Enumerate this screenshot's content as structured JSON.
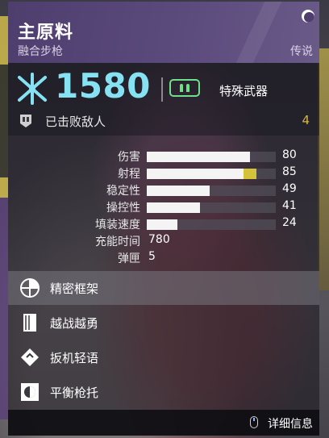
{
  "weapon": {
    "name": "主原料",
    "type": "融合步枪",
    "rarity": "传说",
    "power": "1580",
    "ammo_type": "特殊武器",
    "kills_label": "已击败敌人",
    "kills_value": "4"
  },
  "stats": [
    {
      "label": "伤害",
      "value": "80",
      "fill": 0.8,
      "mod": 0
    },
    {
      "label": "射程",
      "value": "85",
      "fill": 0.75,
      "mod": 0.1
    },
    {
      "label": "稳定性",
      "value": "49",
      "fill": 0.49,
      "mod": 0
    },
    {
      "label": "操控性",
      "value": "41",
      "fill": 0.41,
      "mod": 0
    },
    {
      "label": "填装速度",
      "value": "24",
      "fill": 0.24,
      "mod": 0
    },
    {
      "label": "充能时间",
      "value": "780"
    },
    {
      "label": "弹匣",
      "value": "5"
    }
  ],
  "perks": [
    {
      "label": "精密框架",
      "icon": "precision-frame-icon",
      "selected": true
    },
    {
      "label": "越战越勇",
      "icon": "rampage-icon",
      "selected": false
    },
    {
      "label": "扳机轻语",
      "icon": "triggered-whisper-icon",
      "selected": false
    },
    {
      "label": "平衡枪托",
      "icon": "balanced-stock-icon",
      "selected": false
    }
  ],
  "footer": {
    "details_label": "详细信息"
  },
  "colors": {
    "header": "#4e3e6e",
    "power": "#86e2f2",
    "ammo": "#6ee08a",
    "kills": "#d4b64a",
    "stat_mod": "#d4c23a"
  }
}
